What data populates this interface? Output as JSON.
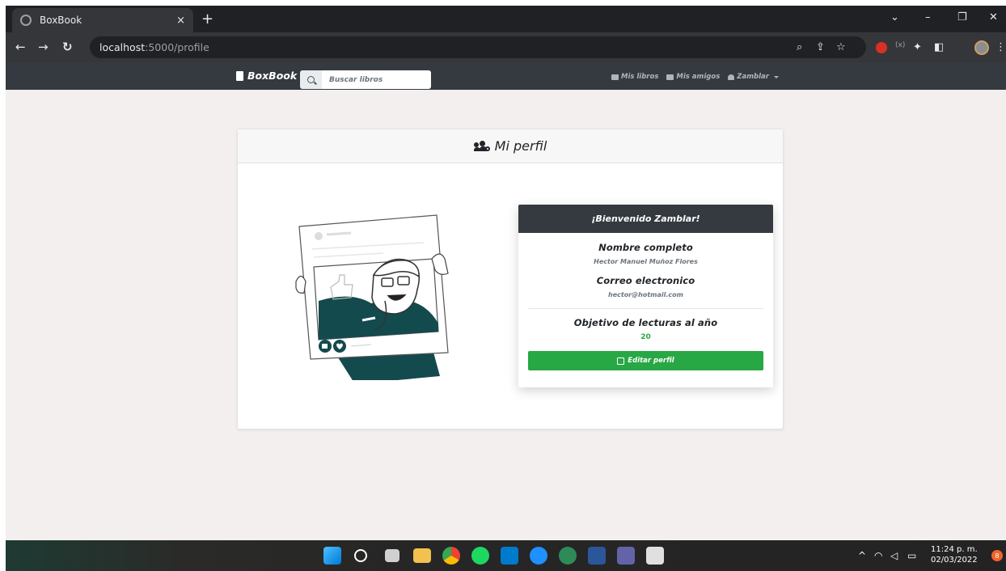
{
  "browser": {
    "tab_title": "BoxBook",
    "tab_close": "×",
    "new_tab": "+",
    "url_host": "localhost",
    "url_path": ":5000/profile"
  },
  "site": {
    "brand": "BoxBook",
    "search_placeholder": "Buscar libros",
    "nav": {
      "books": "Mis libros",
      "friends": "Mis amigos",
      "user": "Zamblar"
    }
  },
  "profile": {
    "title": "Mi perfil",
    "welcome": "¡Bienvenido Zamblar!",
    "full_name_label": "Nombre completo",
    "full_name": "Hector Manuel Muñoz Flores",
    "email_label": "Correo electronico",
    "email": "hector@hotmail.com",
    "goal_label": "Objetivo de lecturas al año",
    "goal": "20",
    "edit_button": "Editar perfil"
  },
  "taskbar": {
    "time": "11:24 p. m.",
    "date": "02/03/2022",
    "notifications": "8"
  },
  "colors": {
    "navbar": "#343a40",
    "page_bg": "#f2efee",
    "accent_green": "#28a745",
    "illustration_teal": "#134a4d"
  }
}
